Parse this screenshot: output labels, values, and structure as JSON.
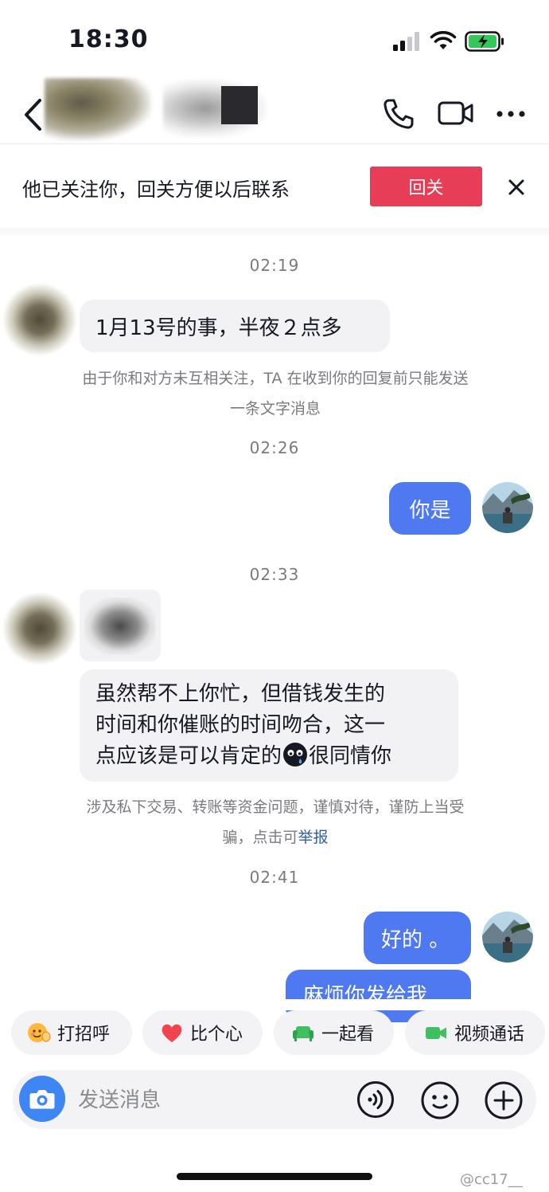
{
  "status_bar": {
    "time": "18:30"
  },
  "banner": {
    "text": "他已关注你，回关方便以后联系",
    "follow_back": "回关"
  },
  "messages": {
    "t1": "02:19",
    "m1": "1月13号的事，半夜２点多",
    "notice1_l1": "由于你和对方未互相关注，TA 在收到你的回复前只能发送",
    "notice1_l2": "一条文字消息",
    "t2": "02:26",
    "m2": "你是",
    "t3": "02:33",
    "m3_l1": "虽然帮不上你忙，但借钱发生的",
    "m3_l2": "时间和你催账的时间吻合，这一",
    "m3_l3a": "点应该是可以肯定的",
    "m3_l3b": "很同情你",
    "notice2_l1": "涉及私下交易、转账等资金问题，谨慎对待，谨防上当受",
    "notice2_l2a": "骗，点击可",
    "notice2_link": "举报",
    "t4": "02:41",
    "m4": "好的 。",
    "m5": "麻烦你发给我"
  },
  "quick_actions": {
    "greet": "打招呼",
    "heart": "比个心",
    "watch": "一起看",
    "video": "视频通话"
  },
  "composer": {
    "placeholder": "发送消息"
  },
  "watermark": "@cc17__",
  "colors": {
    "accent_red": "#e73d56",
    "bubble_blue": "#4f79f1",
    "camera_blue": "#3f86f5",
    "link_blue": "#2e5fa8"
  }
}
